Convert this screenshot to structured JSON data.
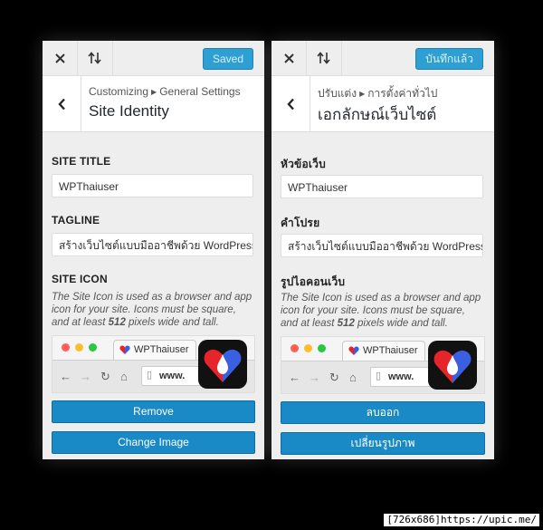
{
  "panels": [
    {
      "top_bar": {
        "save_label": "Saved",
        "save_bg": "#2e9fd2"
      },
      "breadcrumb": {
        "root": "Customizing",
        "section": "General Settings"
      },
      "title": "Site Identity",
      "site_title": {
        "label": "SITE TITLE",
        "value": "WPThaiuser"
      },
      "tagline": {
        "label": "TAGLINE",
        "value": "สร้างเว็บไซต์แบบมืออาชีพด้วย WordPress"
      },
      "site_icon": {
        "label": "SITE ICON",
        "desc_before": "The Site Icon is used as a browser and app icon for your site. Icons must be square, and at least ",
        "desc_size": "512",
        "desc_after": " pixels wide and tall."
      },
      "preview": {
        "tab_title": "WPThaiuser",
        "url_text": "www."
      },
      "remove_label": "Remove",
      "change_label": "Change Image"
    },
    {
      "top_bar": {
        "save_label": "บันทึกแล้ว",
        "save_bg": "#2e9fd2"
      },
      "breadcrumb": {
        "root": "ปรับแต่ง",
        "section": "การตั้งค่าทั่วไป"
      },
      "title": "เอกลักษณ์เว็บไซต์",
      "site_title": {
        "label": "หัวข้อเว็บ",
        "value": "WPThaiuser"
      },
      "tagline": {
        "label": "คำโปรย",
        "value": "สร้างเว็บไซต์แบบมืออาชีพด้วย WordPress"
      },
      "site_icon": {
        "label": "รูปไอคอนเว็บ",
        "desc_before": "The Site Icon is used as a browser and app icon for your site. Icons must be square, and at least ",
        "desc_size": "512",
        "desc_after": " pixels wide and tall."
      },
      "preview": {
        "tab_title": "WPThaiuser",
        "url_text": "www."
      },
      "remove_label": "ลบออก",
      "change_label": "เปลี่ยนรูปภาพ"
    }
  ],
  "icons": {
    "close": "close-icon",
    "sort": "sort-arrows-icon",
    "back": "chevron-left-icon",
    "traffic_lights": [
      "#ff5f57",
      "#ffbd2e",
      "#28c940"
    ],
    "logo_colors": {
      "red": "#e5252a",
      "blue": "#3a5fe0",
      "drop": "#ffffff"
    }
  },
  "watermark": "[726x686]https://upic.me/",
  "colors": {
    "accent": "#1a8ac6",
    "panel_bg": "#eeeeee",
    "page_bg": "#000000"
  }
}
